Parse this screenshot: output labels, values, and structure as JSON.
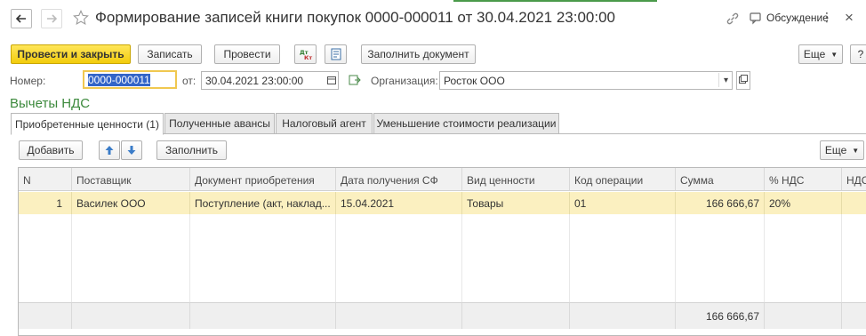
{
  "window": {
    "title": "Формирование записей книги покупок 0000-000011 от 30.04.2021 23:00:00",
    "discussion_label": "Обсуждение"
  },
  "toolbar": {
    "post_and_close": "Провести и закрыть",
    "save": "Записать",
    "post": "Провести",
    "fill_document": "Заполнить документ",
    "more": "Еще",
    "help": "?"
  },
  "header": {
    "number_label": "Номер:",
    "number_value": "0000-000011",
    "date_label": "от:",
    "date_value": "30.04.2021 23:00:00",
    "org_label": "Организация:",
    "org_value": "Росток ООО"
  },
  "section_title": "Вычеты НДС",
  "tabs": [
    {
      "label": "Приобретенные ценности (1)",
      "active": true
    },
    {
      "label": "Полученные авансы",
      "active": false
    },
    {
      "label": "Налоговый агент",
      "active": false
    },
    {
      "label": "Уменьшение стоимости реализации",
      "active": false
    }
  ],
  "table_toolbar": {
    "add": "Добавить",
    "fill": "Заполнить",
    "more": "Еще"
  },
  "table": {
    "columns": [
      "N",
      "Поставщик",
      "Документ приобретения",
      "Дата получения СФ",
      "Вид ценности",
      "Код операции",
      "Сумма",
      "% НДС",
      "НДС"
    ],
    "rows": [
      [
        "1",
        "Василек ООО",
        "Поступление (акт, наклад...",
        "15.04.2021",
        "Товары",
        "01",
        "166 666,67",
        "20%",
        ""
      ]
    ],
    "footer_total": "166 666,67"
  },
  "colors": {
    "accent_green": "#3d8a3d",
    "primary_button": "#f5d41a",
    "selected_row": "#fbf0c0"
  }
}
